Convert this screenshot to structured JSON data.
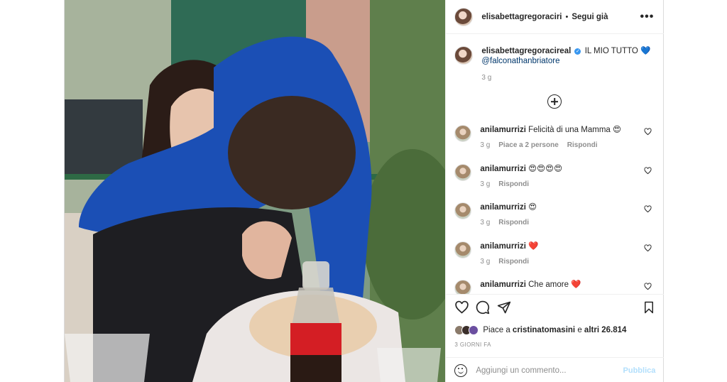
{
  "header": {
    "username": "elisabettagregoraciri",
    "separator": "•",
    "follow_label": "Segui già",
    "more_icon": "more-horizontal-icon"
  },
  "caption": {
    "username": "elisabettagregoracireal",
    "text": "IL MIO TUTTO 💙",
    "mention": "@falconathanbriatore",
    "time": "3 g"
  },
  "comments": [
    {
      "username": "anilamurrizi",
      "text": "Felicità di una Mamma 😍",
      "time": "3 g",
      "likes": "Piace a 2 persone",
      "reply": "Rispondi"
    },
    {
      "username": "anilamurrizi",
      "text": "😍😍😍😍",
      "time": "3 g",
      "likes": "",
      "reply": "Rispondi"
    },
    {
      "username": "anilamurrizi",
      "text": "😍",
      "time": "3 g",
      "likes": "",
      "reply": "Rispondi"
    },
    {
      "username": "anilamurrizi",
      "text": "❤️",
      "time": "3 g",
      "likes": "",
      "reply": "Rispondi"
    },
    {
      "username": "anilamurrizi",
      "text": "Che amore ❤️",
      "time": "",
      "likes": "",
      "reply": ""
    }
  ],
  "likes": {
    "prefix": "Piace a ",
    "user": "cristinatomasini",
    "middle": " e ",
    "others": "altri 26.814"
  },
  "date_label": "3 GIORNI FA",
  "add_comment": {
    "placeholder": "Aggiungi un commento...",
    "publish_label": "Pubblica"
  },
  "colors": {
    "text": "#262626",
    "secondary": "#8e8e8e",
    "link": "#00376b",
    "publish_disabled": "#b2dffc",
    "verified": "#3897f0"
  }
}
